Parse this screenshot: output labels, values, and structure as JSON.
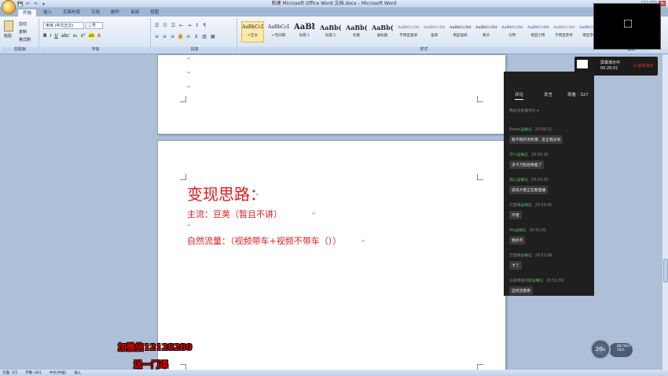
{
  "window": {
    "title": "新建 Microsoft Office Word 文档.docx - Microsoft Word"
  },
  "quick_access": [
    "💾",
    "↶",
    "↷",
    "▾"
  ],
  "tabs": [
    "开始",
    "插入",
    "页面布局",
    "引用",
    "邮件",
    "审阅",
    "视图"
  ],
  "ribbon": {
    "clipboard": {
      "paste": "粘贴",
      "cut": "剪切",
      "copy": "复制",
      "format_painter": "格式刷",
      "label": "剪贴板"
    },
    "font": {
      "family": "宋体 (中文正文)",
      "size": "二号",
      "label": "字体"
    },
    "paragraph": {
      "label": "段落"
    },
    "styles": {
      "label": "样式",
      "items": [
        {
          "sample": "AaBbCcDd",
          "name": "↵正文",
          "selected": true
        },
        {
          "sample": "AaBbCcDd",
          "name": "↵无间隔"
        },
        {
          "sample": "AaBb",
          "name": "标题 1"
        },
        {
          "sample": "AaBb(",
          "name": "标题 2"
        },
        {
          "sample": "AaBb(",
          "name": "标题"
        },
        {
          "sample": "AaBb(",
          "name": "副标题"
        },
        {
          "sample": "AaBbCcDd",
          "name": "不明显强调"
        },
        {
          "sample": "AaBbCcDd",
          "name": "强调"
        },
        {
          "sample": "AaBbCcDd",
          "name": "明显强调"
        },
        {
          "sample": "AaBbCcDd",
          "name": "要点"
        },
        {
          "sample": "AaBbCcDd",
          "name": "引用"
        },
        {
          "sample": "AaBbCcDd",
          "name": "明显引用"
        },
        {
          "sample": "AaBbCcDd",
          "name": "不明显参考"
        },
        {
          "sample": "AaBbCcDo",
          "name": "明显参考"
        }
      ]
    },
    "editing": {
      "label": "编辑"
    }
  },
  "document": {
    "heading": "变现思路：",
    "line1": "主流：豆荚（暂且不讲）",
    "line2": "自然流量：（视频带车+视频不带车（））"
  },
  "status_bar": {
    "page": "页面: 5/5",
    "words": "字数: 841",
    "lang": "中文(中国)",
    "mode": "插入"
  },
  "live": {
    "recording_label": "屏幕演示中",
    "recording_time": "00:26:01",
    "exit_label": "退出演示",
    "tabs": {
      "comments": "评论",
      "send": "发言",
      "viewers": "观看 · 327"
    },
    "filter": "我会写发播评论 ▾",
    "messages": [
      {
        "user": "Edwin",
        "sub": "@微信",
        "time": "20:50:11",
        "text": "稳不稳的无所谓，反正我没有"
      },
      {
        "user": "学少",
        "sub": "@微信",
        "time": "20:50:16",
        "text": "没卡万别后悔差了"
      },
      {
        "user": "蒲公",
        "sub": "@微信",
        "time": "20:50:33",
        "text": "说说大佬正在看直播"
      },
      {
        "user": "万芸琳",
        "sub": "@微信",
        "time": "20:50:45",
        "text": "不错"
      },
      {
        "user": "Mo",
        "sub": "@微信",
        "time": "20:51:01",
        "text": "我听不"
      },
      {
        "user": "万芸琳",
        "sub": "@微信",
        "time": "20:51:06",
        "text": "卡了"
      },
      {
        "user": "以前网络问题",
        "sub": "@微信",
        "time": "20:51:39",
        "text": "自然流量看"
      }
    ]
  },
  "overlay": {
    "line1": "加微信12128280",
    "line2": "送一门课"
  },
  "speed": {
    "percent": "20",
    "up": "68.5K/s",
    "down": "1K/s"
  },
  "colors": {
    "accent_red": "#e0191e",
    "ribbon_blue": "#15396a"
  }
}
